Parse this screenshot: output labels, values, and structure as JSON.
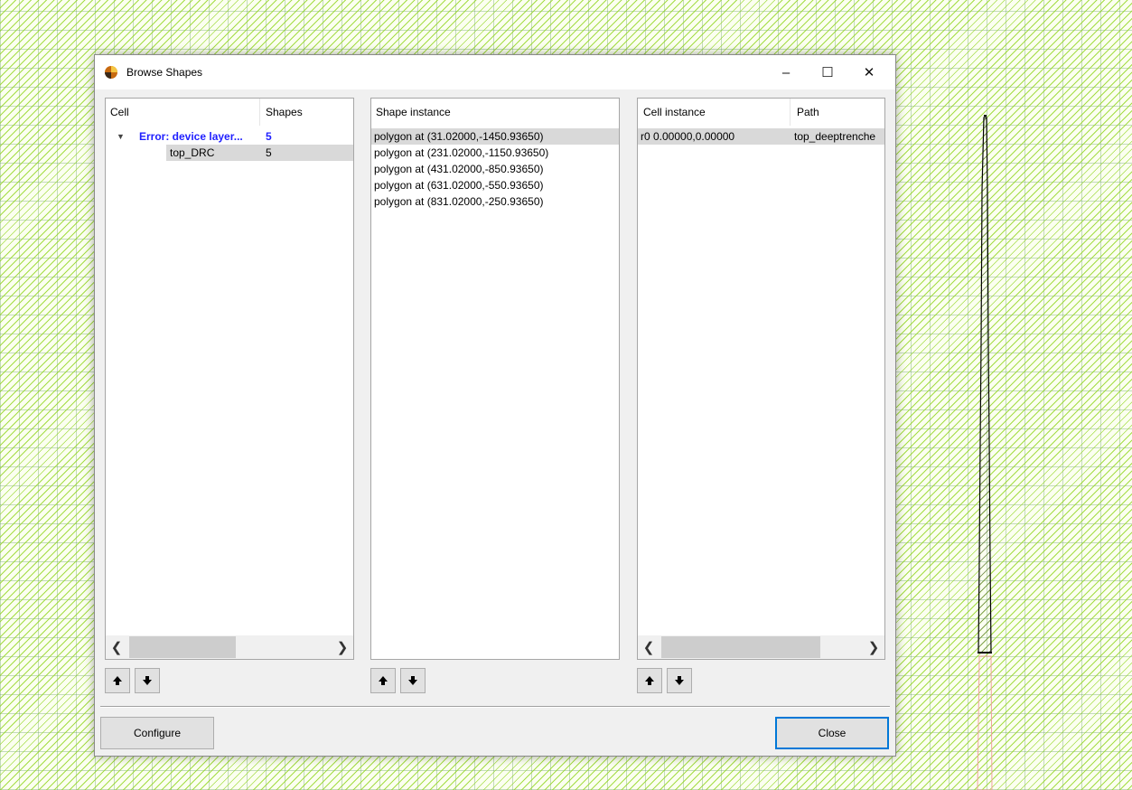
{
  "window": {
    "title": "Browse Shapes",
    "minimize_label": "–",
    "maximize_label": "☐",
    "close_label": "✕"
  },
  "cell_panel": {
    "headers": [
      "Cell",
      "Shapes"
    ],
    "rows": [
      {
        "name": "Error: device layer...",
        "count": "5",
        "expanded": true,
        "color": "#1f1fff"
      },
      {
        "name": "top_DRC",
        "count": "5",
        "selected": true
      }
    ]
  },
  "shape_panel": {
    "header": "Shape instance",
    "rows": [
      "polygon at (31.02000,-1450.93650)",
      "polygon at (231.02000,-1150.93650)",
      "polygon at (431.02000,-850.93650)",
      "polygon at (631.02000,-550.93650)",
      "polygon at (831.02000,-250.93650)"
    ]
  },
  "instance_panel": {
    "headers": [
      "Cell instance",
      "Path"
    ],
    "rows": [
      {
        "instance": "r0 0.00000,0.00000",
        "path": "top_deeptrenche"
      }
    ]
  },
  "icons": {
    "up": "arrow-up-icon",
    "down": "arrow-down-icon",
    "scroll_left": "chevron-left-icon",
    "scroll_right": "chevron-right-icon"
  },
  "buttons": {
    "configure": "Configure",
    "close": "Close"
  },
  "colors": {
    "selection": "#d9d9d9",
    "error_text": "#1f1fff",
    "default_button_border": "#0078d7"
  }
}
